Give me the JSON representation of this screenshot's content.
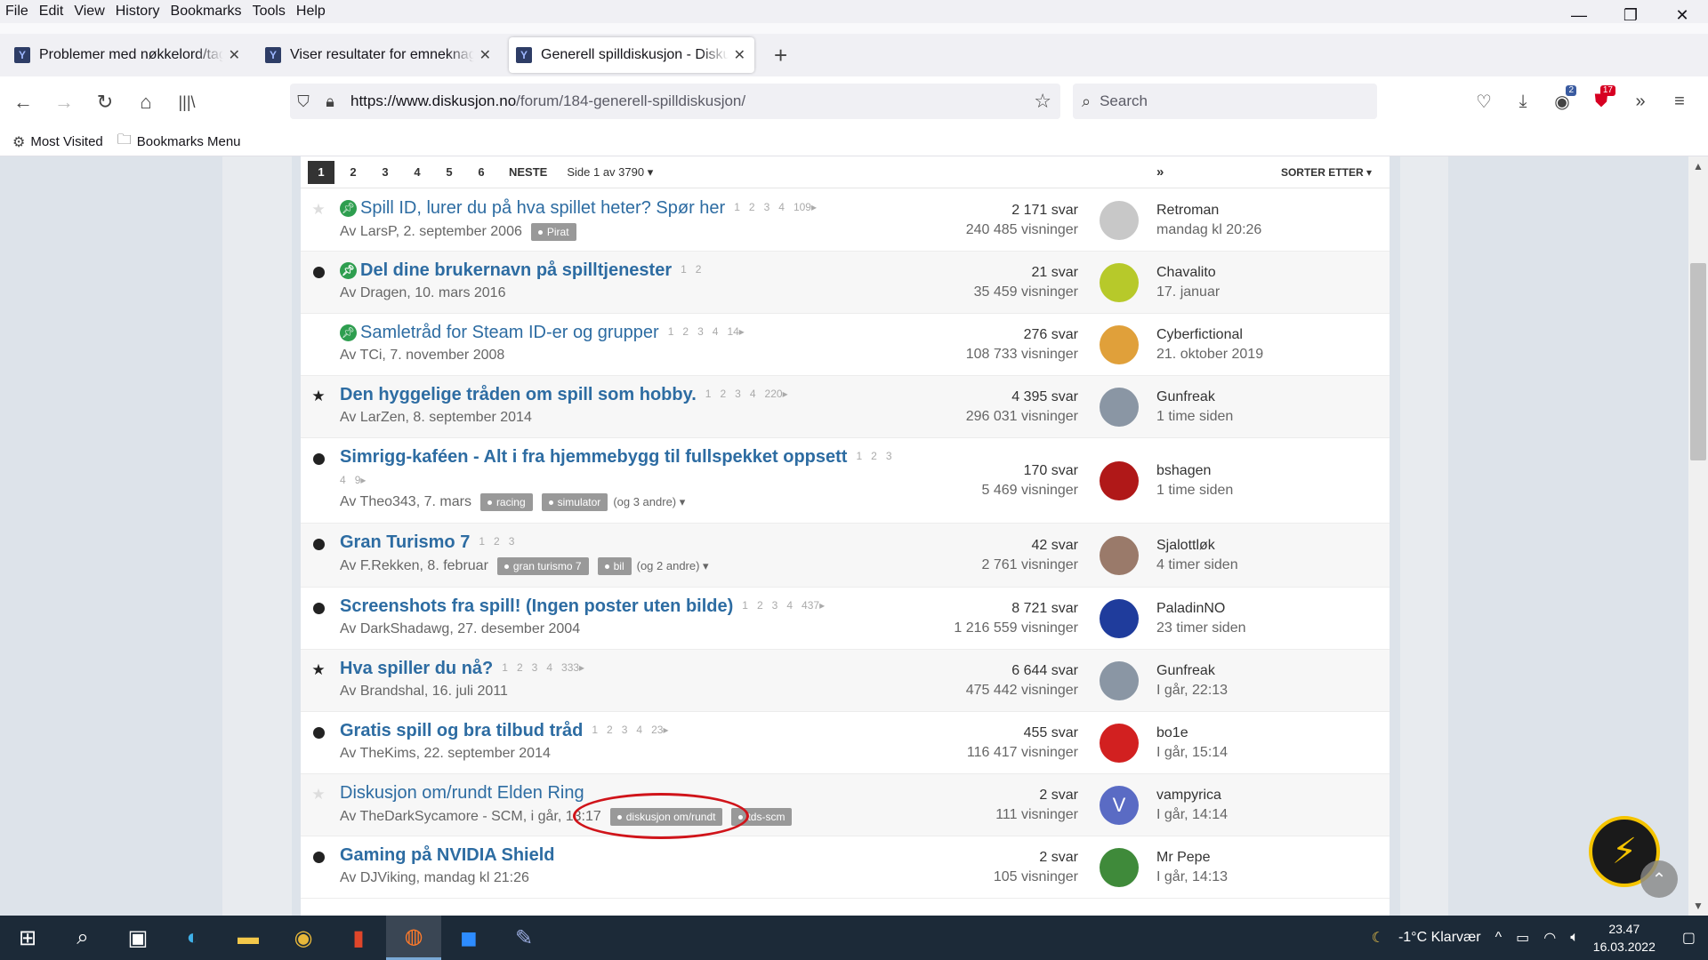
{
  "menu": [
    "File",
    "Edit",
    "View",
    "History",
    "Bookmarks",
    "Tools",
    "Help"
  ],
  "window_controls": {
    "minimize": "—",
    "restore": "❐",
    "close": "✕"
  },
  "tabs": [
    {
      "title": "Problemer med nøkkelord/tags",
      "active": false
    },
    {
      "title": "Viser resultater for emneknagger",
      "active": false
    },
    {
      "title": "Generell spilldiskusjon - Diskusjon.no",
      "active": true
    }
  ],
  "url": {
    "host": "https://www.diskusjon.no",
    "path": "/forum/184-generell-spilldiskusjon/"
  },
  "search": {
    "placeholder": "Search"
  },
  "toolbar_badges": {
    "containers": "2",
    "ublock": "17"
  },
  "bookmarks": [
    "Most Visited",
    "Bookmarks Menu"
  ],
  "pager": {
    "pages": [
      "1",
      "2",
      "3",
      "4",
      "5",
      "6"
    ],
    "current": "1",
    "next": "NESTE",
    "last": "»",
    "of": "Side 1 av 3790",
    "sort": "SORTER ETTER"
  },
  "topics": [
    {
      "title": "Spill ID, lurer du på hva spillet heter? Spør her",
      "bold": false,
      "pinned": true,
      "mark": "star-light",
      "pages": [
        "1",
        "2",
        "3",
        "4",
        "109▸"
      ],
      "meta": "Av LarsP, 2. september 2006",
      "tags": [
        "Pirat"
      ],
      "more": "",
      "replies": "2 171 svar",
      "views": "240 485 visninger",
      "last_user": "Retroman",
      "last_time": "mandag kl 20:26",
      "avatar_color": "#c8c8c8"
    },
    {
      "title": "Del dine brukernavn på spilltjenester",
      "bold": true,
      "pinned": true,
      "mark": "dot",
      "pages": [
        "1",
        "2"
      ],
      "meta": "Av Dragen, 10. mars 2016",
      "tags": [],
      "more": "",
      "replies": "21 svar",
      "views": "35 459 visninger",
      "last_user": "Chavalito",
      "last_time": "17. januar",
      "avatar_color": "#b7c92a"
    },
    {
      "title": "Samletråd for Steam ID-er og grupper",
      "bold": false,
      "pinned": true,
      "mark": "none",
      "pages": [
        "1",
        "2",
        "3",
        "4",
        "14▸"
      ],
      "meta": "Av TCi, 7. november 2008",
      "tags": [],
      "more": "",
      "replies": "276 svar",
      "views": "108 733 visninger",
      "last_user": "Cyberfictional",
      "last_time": "21. oktober 2019",
      "avatar_color": "#e0a03a"
    },
    {
      "title": "Den hyggelige tråden om spill som hobby.",
      "bold": true,
      "pinned": false,
      "mark": "star-dark",
      "pages": [
        "1",
        "2",
        "3",
        "4",
        "220▸"
      ],
      "meta": "Av LarZen, 8. september 2014",
      "tags": [],
      "more": "",
      "replies": "4 395 svar",
      "views": "296 031 visninger",
      "last_user": "Gunfreak",
      "last_time": "1 time siden",
      "avatar_color": "#8a96a4"
    },
    {
      "title": "Simrigg-kaféen - Alt i fra hjemmebygg til fullspekket oppsett",
      "bold": true,
      "pinned": false,
      "mark": "dot",
      "pages": [
        "1",
        "2",
        "3"
      ],
      "pages2": [
        "4",
        "9▸"
      ],
      "meta": "Av Theo343, 7. mars",
      "tags": [
        "racing",
        "simulator"
      ],
      "more": "(og 3 andre) ▾",
      "replies": "170 svar",
      "views": "5 469 visninger",
      "last_user": "bshagen",
      "last_time": "1 time siden",
      "avatar_color": "#b01818"
    },
    {
      "title": "Gran Turismo 7",
      "bold": true,
      "pinned": false,
      "mark": "dot",
      "pages": [
        "1",
        "2",
        "3"
      ],
      "meta": "Av F.Rekken, 8. februar",
      "tags": [
        "gran turismo 7",
        "bil"
      ],
      "more": "(og 2 andre) ▾",
      "replies": "42 svar",
      "views": "2 761 visninger",
      "last_user": "Sjalottløk",
      "last_time": "4 timer siden",
      "avatar_color": "#9a7a6a"
    },
    {
      "title": "Screenshots fra spill! (Ingen poster uten bilde)",
      "bold": true,
      "pinned": false,
      "mark": "dot",
      "pages": [
        "1",
        "2",
        "3",
        "4",
        "437▸"
      ],
      "meta": "Av DarkShadawg, 27. desember 2004",
      "tags": [],
      "more": "",
      "replies": "8 721 svar",
      "views": "1 216 559 visninger",
      "last_user": "PaladinNO",
      "last_time": "23 timer siden",
      "avatar_color": "#1f3c9c"
    },
    {
      "title": "Hva spiller du nå?",
      "bold": true,
      "pinned": false,
      "mark": "star-dark",
      "pages": [
        "1",
        "2",
        "3",
        "4",
        "333▸"
      ],
      "meta": "Av Brandshal, 16. juli 2011",
      "tags": [],
      "more": "",
      "replies": "6 644 svar",
      "views": "475 442 visninger",
      "last_user": "Gunfreak",
      "last_time": "I går, 22:13",
      "avatar_color": "#8a96a4"
    },
    {
      "title": "Gratis spill og bra tilbud tråd",
      "bold": true,
      "pinned": false,
      "mark": "dot",
      "pages": [
        "1",
        "2",
        "3",
        "4",
        "23▸"
      ],
      "meta": "Av TheKims, 22. september 2014",
      "tags": [],
      "more": "",
      "replies": "455 svar",
      "views": "116 417 visninger",
      "last_user": "bo1e",
      "last_time": "I går, 15:14",
      "avatar_color": "#d22020"
    },
    {
      "title": "Diskusjon om/rundt Elden Ring",
      "bold": false,
      "pinned": false,
      "mark": "star-light",
      "pages": [],
      "meta": "Av TheDarkSycamore - SCM, i går, 13:17",
      "tags": [
        "diskusjon om/rundt",
        "tds-scm"
      ],
      "more": "",
      "replies": "2 svar",
      "views": "111 visninger",
      "last_user": "vampyrica",
      "last_time": "I går, 14:14",
      "avatar_color": "#5a6bc4",
      "avatar_letter": "V"
    },
    {
      "title": "Gaming på NVIDIA Shield",
      "bold": true,
      "pinned": false,
      "mark": "dot",
      "pages": [],
      "meta": "Av DJViking, mandag kl 21:26",
      "tags": [],
      "more": "",
      "replies": "2 svar",
      "views": "105 visninger",
      "last_user": "Mr Pepe",
      "last_time": "I går, 14:13",
      "avatar_color": "#3f8a3a"
    }
  ],
  "taskbar": {
    "weather": "-1°C  Klarvær",
    "time": "23.47",
    "date": "16.03.2022"
  }
}
